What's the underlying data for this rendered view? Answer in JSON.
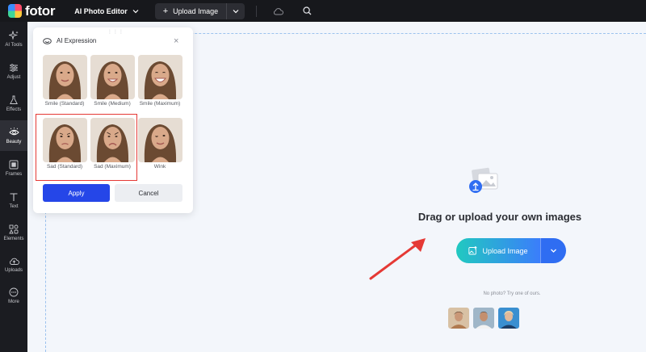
{
  "app": {
    "logo_text": "fotor"
  },
  "topbar": {
    "editor_label": "AI Photo Editor",
    "upload_label": "Upload Image",
    "icons": [
      "cloud-icon",
      "search-icon"
    ]
  },
  "sidebar": {
    "items": [
      {
        "label": "AI Tools",
        "icon": "sparkle-icon"
      },
      {
        "label": "Adjust",
        "icon": "sliders-icon"
      },
      {
        "label": "Effects",
        "icon": "flask-icon"
      },
      {
        "label": "Beauty",
        "icon": "eye-icon",
        "active": true
      },
      {
        "label": "Frames",
        "icon": "frame-icon"
      },
      {
        "label": "Text",
        "icon": "text-icon"
      },
      {
        "label": "Elements",
        "icon": "shapes-icon"
      },
      {
        "label": "Uploads",
        "icon": "cloud-upload-icon"
      },
      {
        "label": "More",
        "icon": "more-icon"
      }
    ]
  },
  "popup": {
    "title": "AI Expression",
    "expressions": [
      {
        "label": "Smile (Standard)"
      },
      {
        "label": "Smile (Medium)"
      },
      {
        "label": "Smile (Maximum)"
      },
      {
        "label": "Sad (Standard)"
      },
      {
        "label": "Sad (Maximum)"
      },
      {
        "label": "Wink"
      }
    ],
    "apply_label": "Apply",
    "cancel_label": "Cancel"
  },
  "canvas": {
    "drop_title": "Drag or upload your own images",
    "upload_label": "Upload Image",
    "no_photo_text": "No photo? Try one of ours."
  },
  "colors": {
    "accent": "#2546e8",
    "highlight": "#e53935",
    "arrow": "#e53935",
    "topbar_bg": "#17181c"
  }
}
